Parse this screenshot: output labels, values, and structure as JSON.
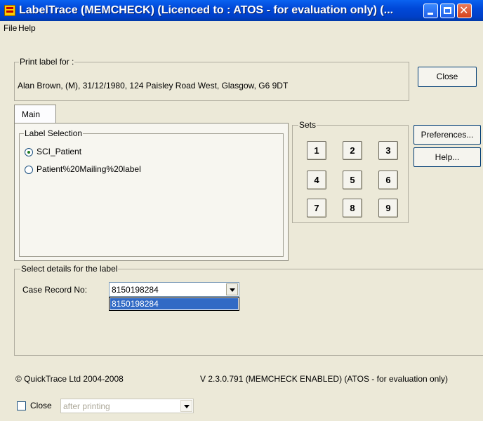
{
  "window": {
    "title": "LabelTrace (MEMCHECK) (Licenced to : ATOS - for evaluation only) (...",
    "icon": "app-label-icon"
  },
  "menu": {
    "file": "File",
    "help": "Help"
  },
  "print_label": {
    "legend": "Print label for :",
    "patient": "Alan Brown, (M), 31/12/1980, 124 Paisley Road West, Glasgow, G6  9DT"
  },
  "buttons": {
    "close": "Close",
    "preferences": "Preferences...",
    "help": "Help..."
  },
  "tabs": [
    {
      "label": "Main",
      "selected": true
    }
  ],
  "label_selection": {
    "legend": "Label Selection",
    "options": [
      {
        "label": "SCI_Patient",
        "checked": true
      },
      {
        "label": "Patient%20Mailing%20label",
        "checked": false
      }
    ]
  },
  "sets": {
    "legend": "Sets",
    "numbers": [
      "1",
      "2",
      "3",
      "4",
      "5",
      "6",
      "7",
      "8",
      "9"
    ]
  },
  "details": {
    "legend": "Select details for the label",
    "case_record_label": "Case Record No:",
    "case_record_value": "8150198284",
    "dropdown_options": [
      "8150198284"
    ]
  },
  "footer": {
    "copyright": "© QuickTrace Ltd 2004-2008",
    "version": "V 2.3.0.791 (MEMCHECK ENABLED)  (ATOS - for evaluation only)"
  },
  "close_option": {
    "checkbox_label": "Close",
    "checked": false,
    "select_value": "after printing"
  }
}
